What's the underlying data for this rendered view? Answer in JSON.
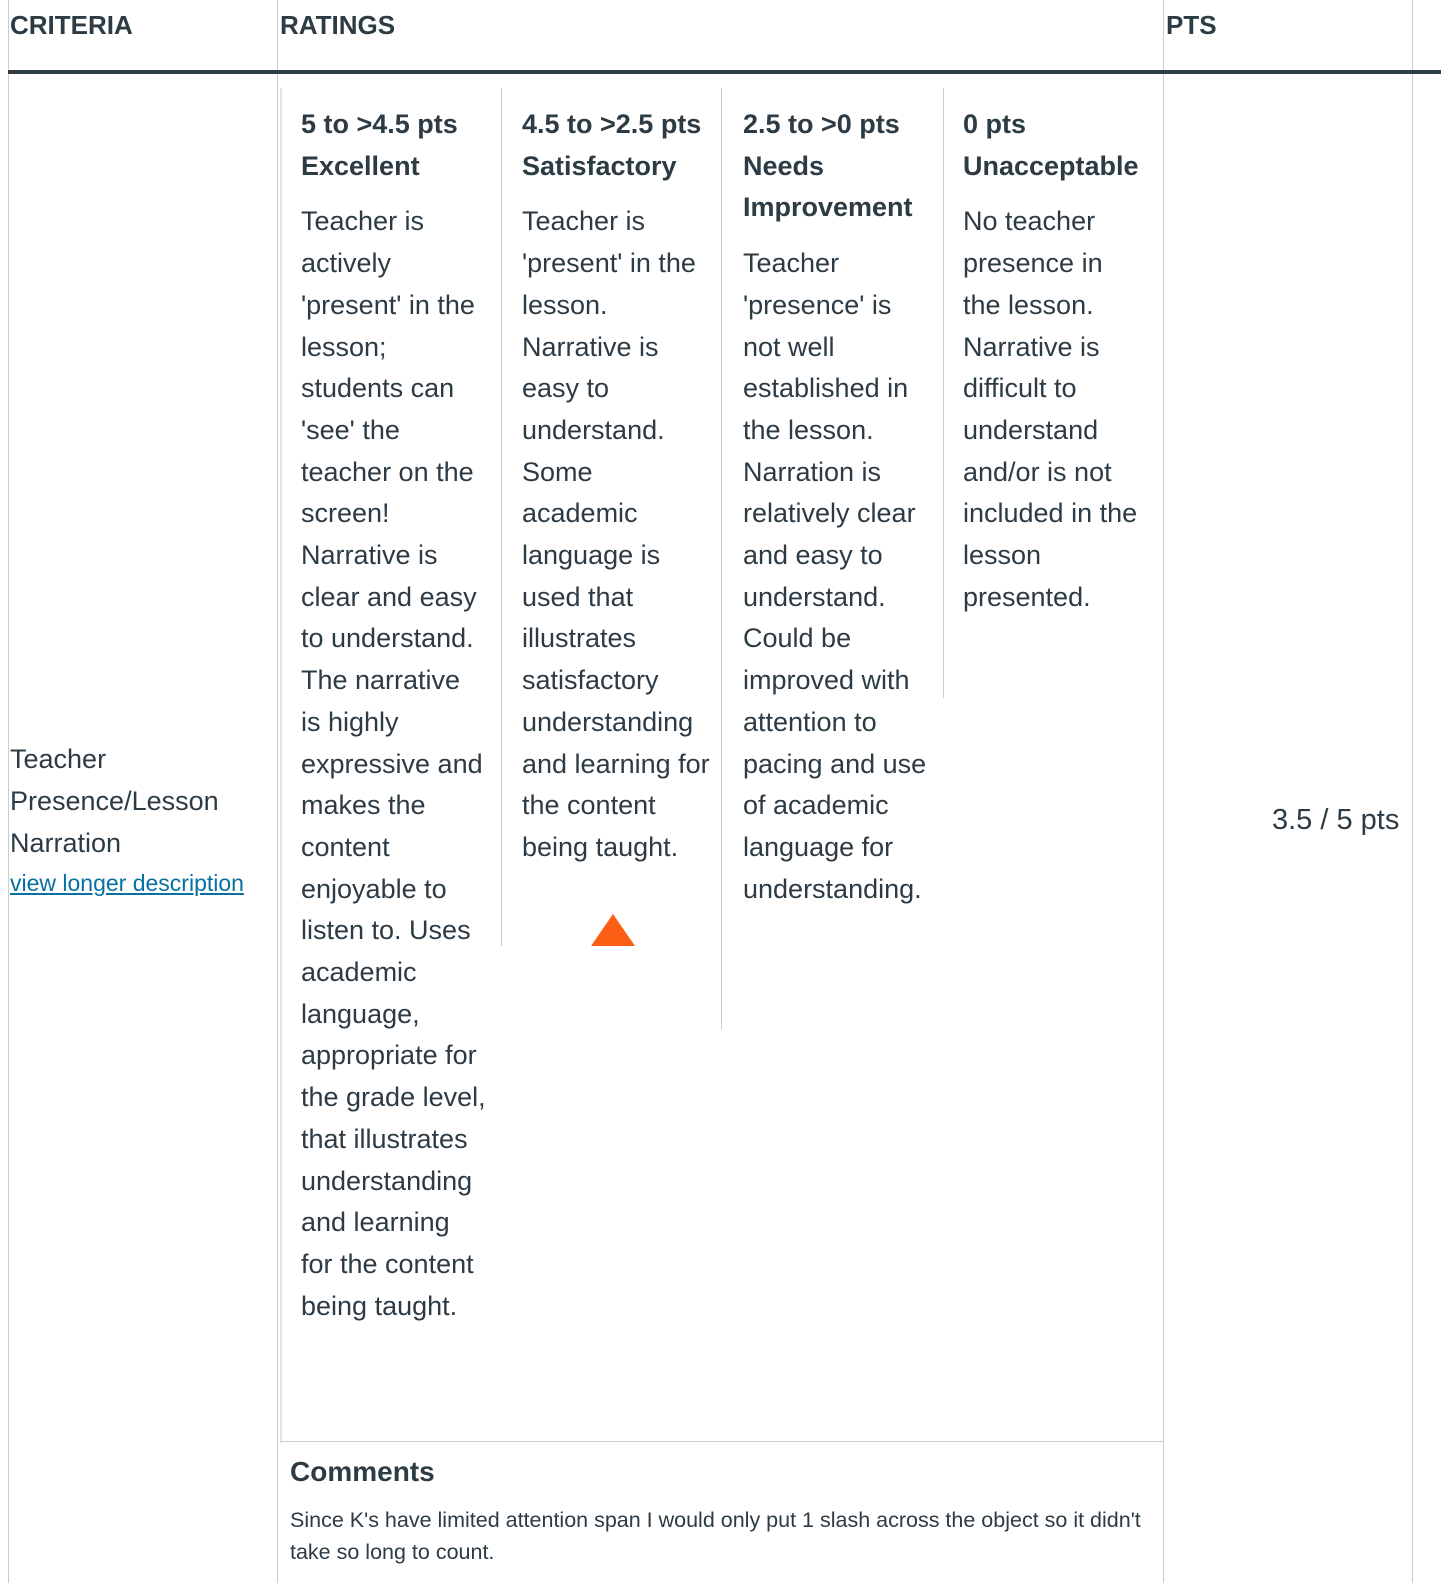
{
  "header": {
    "criteria": "CRITERIA",
    "ratings": "RATINGS",
    "pts": "PTS"
  },
  "criterion": {
    "description": "Teacher Presence/Lesson Narration",
    "long_description_link": "view longer description"
  },
  "ratings": [
    {
      "points": "5 to >4.5 pts",
      "title": "Excellent",
      "description": "Teacher is actively 'present' in the lesson; students can 'see' the teacher on the screen! Narrative is clear and easy to understand. The narrative is highly expressive and makes the content enjoyable to listen to. Uses academic language, appropriate for the grade level, that illustrates understanding and learning for the content being taught."
    },
    {
      "points": "4.5 to >2.5 pts",
      "title": "Satisfactory",
      "description": "Teacher is 'present' in the lesson. Narrative is easy to understand. Some academic language is used that illustrates satisfactory understanding and learning for the content being taught.",
      "selected": true
    },
    {
      "points": "2.5 to >0 pts",
      "title": "Needs Improvement",
      "description": "Teacher 'presence' is not well established in the lesson. Narration is relatively clear and easy to understand. Could be improved with attention to pacing and use of academic language for understanding."
    },
    {
      "points": "0 pts",
      "title": "Unacceptable",
      "description": "No teacher presence in the lesson. Narrative is difficult to understand and/or is not included in the lesson presented."
    }
  ],
  "score": "3.5 / 5 pts",
  "comments": {
    "title": "Comments",
    "text": "Since K's have limited attention span I would only put 1 slash across the object so it didn't take so long to count."
  },
  "colors": {
    "selected_marker": "#fc5e13",
    "link": "#0770a3",
    "text": "#2d3b45",
    "border": "#c7cdd1"
  }
}
